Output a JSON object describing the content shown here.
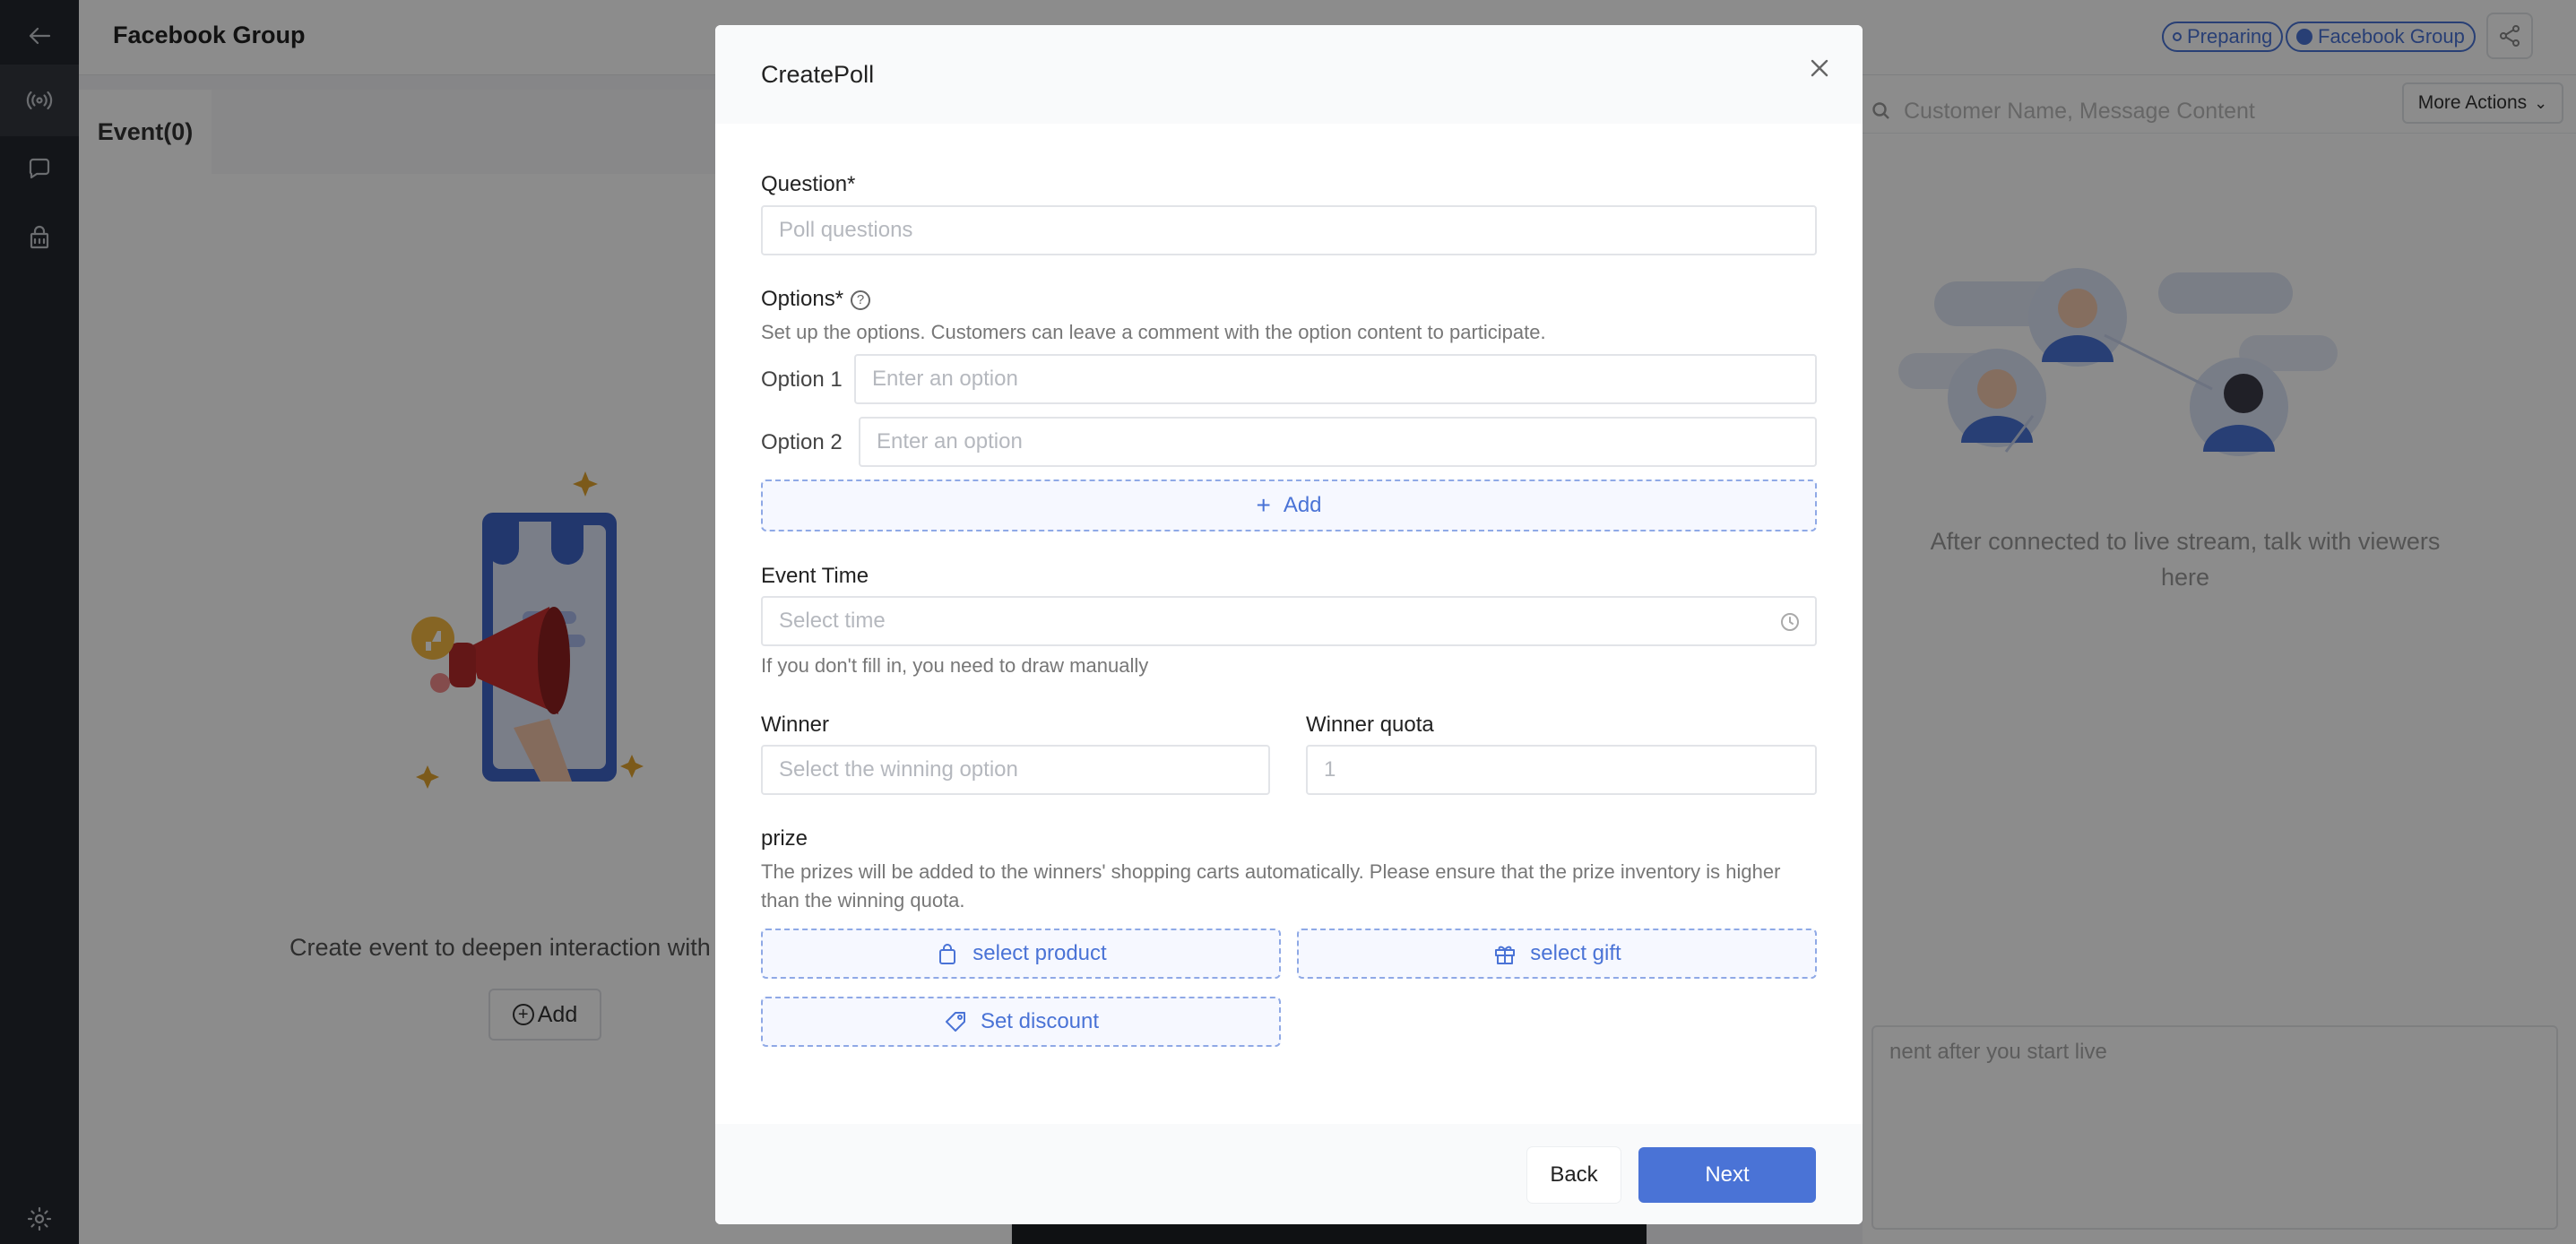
{
  "header": {
    "title": "Facebook Group",
    "status_badge": "Preparing",
    "channel_badge": "Facebook Group"
  },
  "left_panel": {
    "tab_label": "Event(0)",
    "empty_text": "Create event to deepen interaction with",
    "add_label": "Add"
  },
  "right_panel": {
    "search_placeholder": "Customer Name, Message Content",
    "more_actions_label": "More Actions",
    "empty_text": "After connected to live stream, talk with viewers here",
    "comment_placeholder": "nent after you start live"
  },
  "modal": {
    "title": "CreatePoll",
    "question_label": "Question*",
    "question_placeholder": "Poll questions",
    "options_label": "Options*",
    "options_hint": "Set up the options. Customers can leave a comment with the option content to participate.",
    "options": [
      {
        "label": "Option 1",
        "placeholder": "Enter an option"
      },
      {
        "label": "Option 2",
        "placeholder": "Enter an option"
      }
    ],
    "add_option_label": "Add",
    "event_time_label": "Event Time",
    "event_time_placeholder": "Select time",
    "event_time_hint": "If you don't fill in, you need to draw manually",
    "winner_label": "Winner",
    "winner_placeholder": "Select the winning option",
    "winner_quota_label": "Winner quota",
    "winner_quota_placeholder": "1",
    "prize_label": "prize",
    "prize_hint_line1": "The prizes will be added to the winners' shopping carts automatically. Please ensure that the prize inventory is higher",
    "prize_hint_line2": "than the winning quota.",
    "select_product_label": "select product",
    "select_gift_label": "select gift",
    "set_discount_label": "Set discount",
    "back_label": "Back",
    "next_label": "Next"
  },
  "colors": {
    "accent": "#4a73d6",
    "rail": "#24272e"
  }
}
